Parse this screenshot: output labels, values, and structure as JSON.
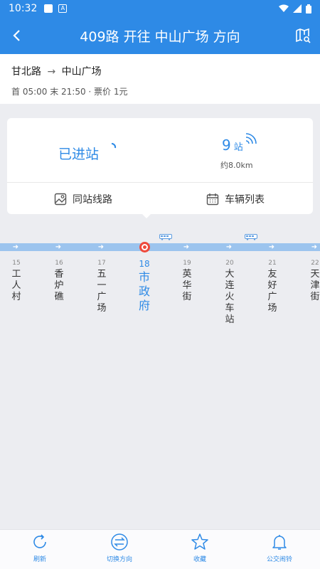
{
  "status": {
    "time": "10:32"
  },
  "header": {
    "title": "409路 开往 中山广场 方向"
  },
  "info": {
    "from": "甘北路",
    "arrow": "→",
    "to": "中山广场",
    "times": "首 05:00 末 21:50 · 票价 1元"
  },
  "card": {
    "arrived_label": "已进站",
    "stops_count": "9",
    "stops_unit": "站",
    "distance": "约8.0km",
    "same_station_label": "同站线路",
    "vehicle_list_label": "车辆列表"
  },
  "stations": [
    {
      "no": "15",
      "name": [
        "工",
        "人",
        "村"
      ]
    },
    {
      "no": "16",
      "name": [
        "香",
        "炉",
        "礁"
      ]
    },
    {
      "no": "17",
      "name": [
        "五",
        "一",
        "广",
        "场"
      ]
    },
    {
      "no": "18",
      "name": [
        "市",
        "政",
        "府"
      ],
      "current": true
    },
    {
      "no": "19",
      "name": [
        "英",
        "华",
        "街"
      ]
    },
    {
      "no": "20",
      "name": [
        "大",
        "连",
        "火",
        "车",
        "站"
      ]
    },
    {
      "no": "21",
      "name": [
        "友",
        "好",
        "广",
        "场"
      ]
    },
    {
      "no": "22",
      "name": [
        "天",
        "津",
        "街"
      ]
    }
  ],
  "tabs": {
    "refresh": "刷新",
    "switch_direction": "切换方向",
    "favorite": "收藏",
    "alarm": "公交闹铃"
  },
  "colors": {
    "primary": "#2e8ae6",
    "current": "#ef4a3c",
    "track": "#9cc4ee"
  },
  "icons": [
    "back-icon",
    "map-search-icon",
    "loading-icon",
    "signal-icon",
    "map-icon",
    "calendar-icon",
    "bus-icon",
    "refresh-icon",
    "switch-icon",
    "star-icon",
    "bell-icon"
  ]
}
